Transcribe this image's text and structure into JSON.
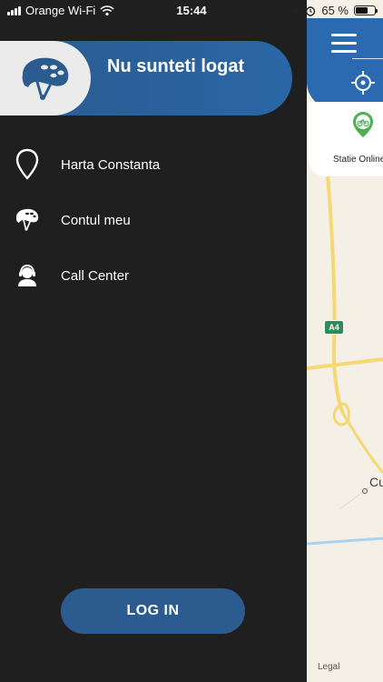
{
  "status_bar": {
    "carrier": "Orange Wi-Fi",
    "time": "15:44",
    "battery_percent": "65 %",
    "battery_level": 0.65
  },
  "drawer": {
    "header_title": "Nu sunteti logat",
    "menu": [
      {
        "label": "Harta Constanta",
        "icon": "map-pin-icon"
      },
      {
        "label": "Contul meu",
        "icon": "helmet-icon"
      },
      {
        "label": "Call Center",
        "icon": "headset-user-icon"
      }
    ],
    "login_label": "LOG IN"
  },
  "map": {
    "station_label": "Statie Online",
    "road_badge": "A4",
    "place_label": "Cu",
    "legal_label": "Legal"
  },
  "colors": {
    "drawer_bg": "#1f1f1f",
    "accent_blue": "#2b5b8f",
    "map_bg": "#f5f0e6",
    "road_yellow": "#f5d774",
    "station_green": "#4caf50"
  }
}
